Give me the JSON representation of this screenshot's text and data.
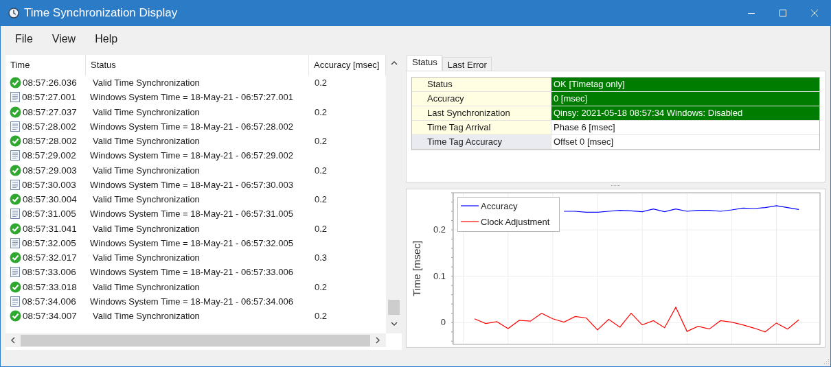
{
  "window": {
    "title": "Time Synchronization Display"
  },
  "menu": [
    "File",
    "View",
    "Help"
  ],
  "log": {
    "columns": [
      "Time",
      "Status",
      "Accuracy [msec]"
    ],
    "rows": [
      {
        "kind": "valid",
        "time": "08:57:26.036",
        "status": "Valid Time Synchronization",
        "accuracy": "0.2"
      },
      {
        "kind": "system",
        "time": "08:57:27.001",
        "status": "Windows System Time = 18-May-21 - 06:57:27.001"
      },
      {
        "kind": "valid",
        "time": "08:57:27.037",
        "status": "Valid Time Synchronization",
        "accuracy": "0.2"
      },
      {
        "kind": "system",
        "time": "08:57:28.002",
        "status": "Windows System Time = 18-May-21 - 06:57:28.002"
      },
      {
        "kind": "valid",
        "time": "08:57:28.002",
        "status": "Valid Time Synchronization",
        "accuracy": "0.2"
      },
      {
        "kind": "system",
        "time": "08:57:29.002",
        "status": "Windows System Time = 18-May-21 - 06:57:29.002"
      },
      {
        "kind": "valid",
        "time": "08:57:29.003",
        "status": "Valid Time Synchronization",
        "accuracy": "0.2"
      },
      {
        "kind": "system",
        "time": "08:57:30.003",
        "status": "Windows System Time = 18-May-21 - 06:57:30.003"
      },
      {
        "kind": "valid",
        "time": "08:57:30.004",
        "status": "Valid Time Synchronization",
        "accuracy": "0.2"
      },
      {
        "kind": "system",
        "time": "08:57:31.005",
        "status": "Windows System Time = 18-May-21 - 06:57:31.005"
      },
      {
        "kind": "valid",
        "time": "08:57:31.041",
        "status": "Valid Time Synchronization",
        "accuracy": "0.2"
      },
      {
        "kind": "system",
        "time": "08:57:32.005",
        "status": "Windows System Time = 18-May-21 - 06:57:32.005"
      },
      {
        "kind": "valid",
        "time": "08:57:32.017",
        "status": "Valid Time Synchronization",
        "accuracy": "0.3"
      },
      {
        "kind": "system",
        "time": "08:57:33.006",
        "status": "Windows System Time = 18-May-21 - 06:57:33.006"
      },
      {
        "kind": "valid",
        "time": "08:57:33.018",
        "status": "Valid Time Synchronization",
        "accuracy": "0.2"
      },
      {
        "kind": "system",
        "time": "08:57:34.006",
        "status": "Windows System Time = 18-May-21 - 06:57:34.006"
      },
      {
        "kind": "valid",
        "time": "08:57:34.007",
        "status": "Valid Time Synchronization",
        "accuracy": "0.2"
      }
    ]
  },
  "tabs": [
    {
      "label": "Status",
      "selected": true
    },
    {
      "label": "Last Error",
      "selected": false
    }
  ],
  "properties": [
    {
      "label": "Status",
      "value": "OK [Timetag only]",
      "ok": true,
      "selected": false
    },
    {
      "label": "Accuracy",
      "value": "0 [msec]",
      "ok": true,
      "selected": false
    },
    {
      "label": "Last Synchronization",
      "value": "Qinsy: 2021-05-18 08:57:34 Windows: Disabled",
      "ok": true,
      "selected": false
    },
    {
      "label": "Time Tag Arrival",
      "value": "Phase 6 [msec]",
      "ok": false,
      "selected": false
    },
    {
      "label": "Time Tag Accuracy",
      "value": "Offset 0 [msec]",
      "ok": false,
      "selected": true
    }
  ],
  "chart": {
    "chart_data": {
      "type": "line",
      "ylabel": "Time [msec]",
      "categories": [
        null,
        null,
        null,
        null,
        null,
        null,
        null,
        null,
        null,
        null,
        null,
        null,
        null,
        null,
        null,
        null,
        null,
        null,
        null,
        null,
        null,
        null,
        null,
        null,
        null,
        null,
        null,
        null,
        null,
        null
      ],
      "ylim": [
        -0.047,
        0.28
      ],
      "yticks": [
        {
          "value": 0,
          "label": "0"
        },
        {
          "value": 0.1,
          "label": "0.1"
        },
        {
          "value": 0.2,
          "label": "0.2"
        }
      ],
      "grid": true,
      "legend": true,
      "series": [
        {
          "name": "Accuracy",
          "color": "#0000ff",
          "values": [
            null,
            null,
            null,
            null,
            null,
            null,
            null,
            null,
            0.24,
            0.24,
            0.238,
            0.238,
            0.24,
            0.242,
            0.241,
            0.239,
            0.245,
            0.239,
            0.245,
            0.24,
            0.242,
            0.242,
            0.24,
            0.243,
            0.247,
            0.246,
            0.248,
            0.252,
            0.248,
            0.244
          ]
        },
        {
          "name": "Clock Adjustment",
          "color": "#ff0000",
          "values": [
            0.008,
            -0.002,
            0.002,
            -0.013,
            0.005,
            0.003,
            0.02,
            0.008,
            0.001,
            0.013,
            0.01,
            -0.016,
            0.007,
            -0.01,
            0.02,
            -0.005,
            0.004,
            -0.011,
            0.033,
            -0.019,
            -0.008,
            -0.014,
            0.004,
            0.001,
            -0.005,
            -0.012,
            -0.02,
            -0.001,
            -0.014,
            0.006
          ]
        }
      ]
    }
  }
}
